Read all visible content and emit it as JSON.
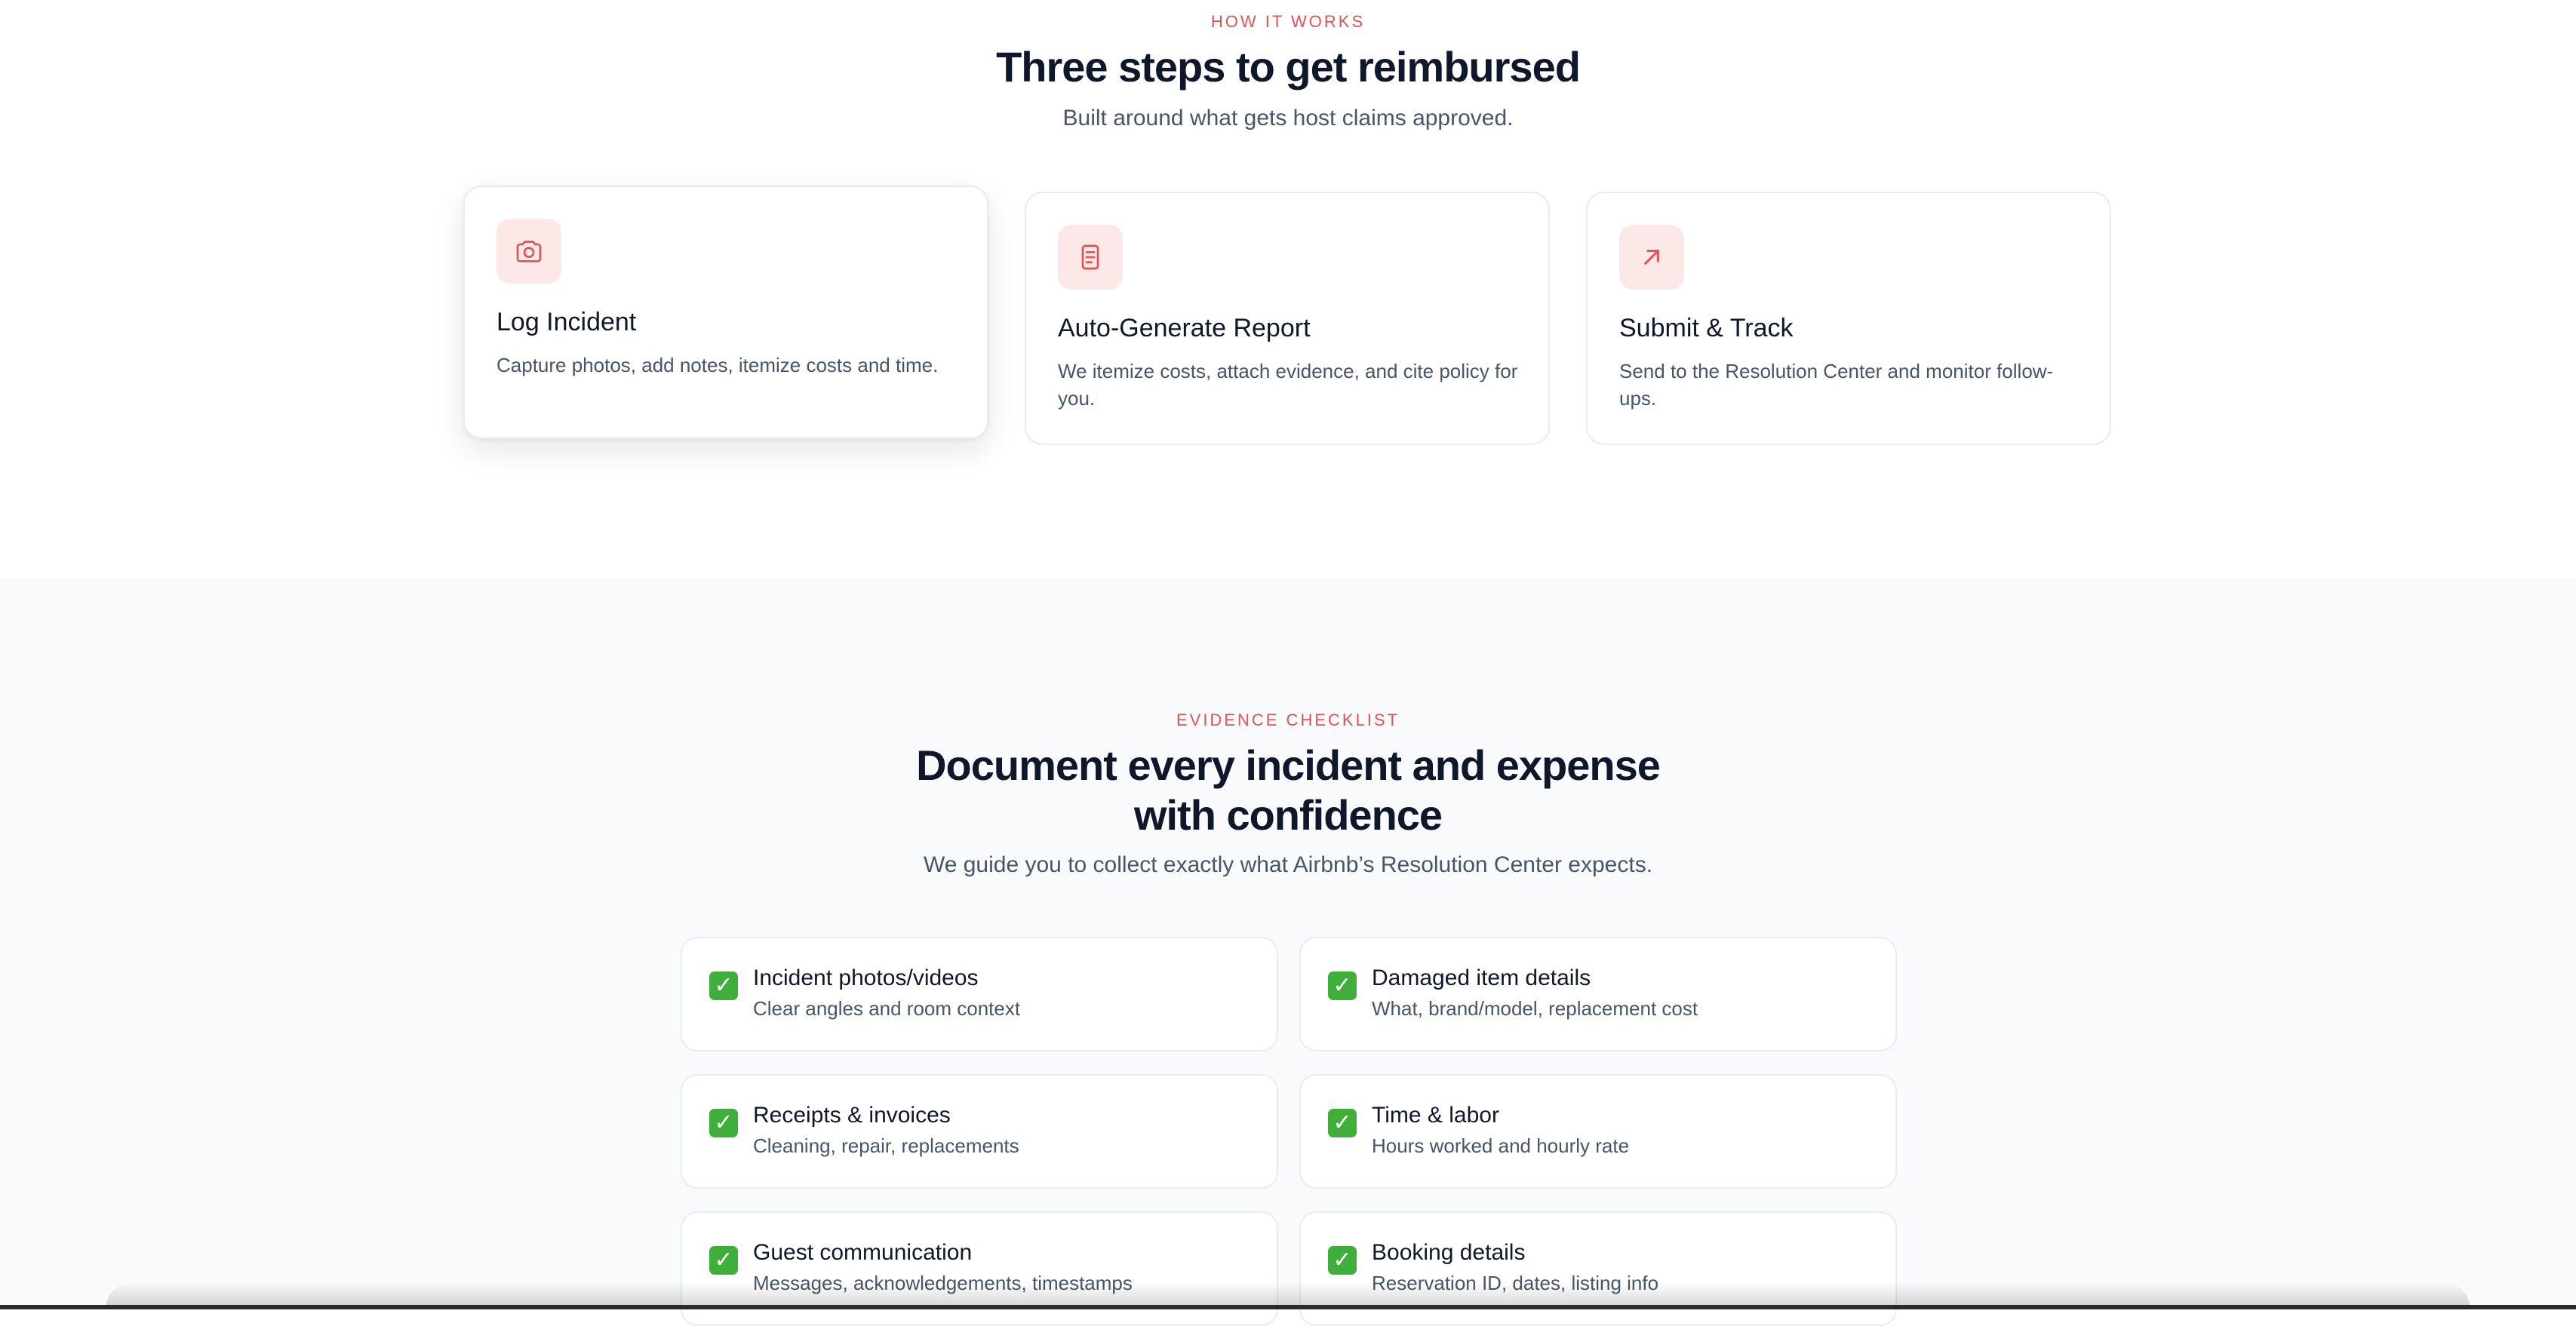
{
  "how_it_works": {
    "eyebrow": "HOW IT WORKS",
    "title": "Three steps to get reimbursed",
    "subtitle": "Built around what gets host claims approved.",
    "steps": [
      {
        "icon": "camera-icon",
        "title": "Log Incident",
        "description": "Capture photos, add notes, itemize costs and time."
      },
      {
        "icon": "document-icon",
        "title": "Auto-Generate Report",
        "description": "We itemize costs, attach evidence, and cite policy for you."
      },
      {
        "icon": "arrow-up-right-icon",
        "title": "Submit & Track",
        "description": "Send to the Resolution Center and monitor follow-ups."
      }
    ]
  },
  "evidence_checklist": {
    "eyebrow": "EVIDENCE CHECKLIST",
    "title": "Document every incident and expense with confidence",
    "subtitle": "We guide you to collect exactly what Airbnb’s Resolution Center expects.",
    "items": [
      {
        "title": "Incident photos/videos",
        "description": "Clear angles and room context",
        "checked": true
      },
      {
        "title": "Damaged item details",
        "description": "What, brand/model, replacement cost",
        "checked": true
      },
      {
        "title": "Receipts & invoices",
        "description": "Cleaning, repair, replacements",
        "checked": true
      },
      {
        "title": "Time & labor",
        "description": "Hours worked and hourly rate",
        "checked": true
      },
      {
        "title": "Guest communication",
        "description": "Messages, acknowledgements, timestamps",
        "checked": true
      },
      {
        "title": "Booking details",
        "description": "Reservation ID, dates, listing info",
        "checked": true
      }
    ],
    "check_glyph": "✓"
  },
  "colors": {
    "accent": "#e15252",
    "icon_tile": "#fde8e8",
    "check_green": "#3fae3b",
    "heading": "#0f172a",
    "body_text": "#475569",
    "section_bg": "#f8fafc"
  }
}
